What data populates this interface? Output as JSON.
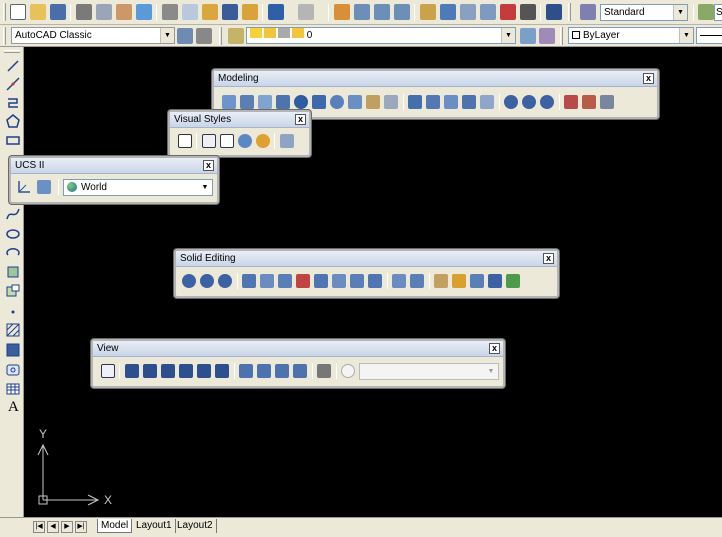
{
  "toolbar1": {
    "text_style_combo": "Standard",
    "cut_text": "S"
  },
  "toolbar2": {
    "workspace_combo": "AutoCAD Classic",
    "layer_combo": "0",
    "color_combo": "ByLayer"
  },
  "panels": {
    "modeling": {
      "title": "Modeling",
      "close": "x"
    },
    "visual_styles": {
      "title": "Visual Styles",
      "close": "x"
    },
    "ucs2": {
      "title": "UCS II",
      "close": "x",
      "combo_value": "World"
    },
    "solid_editing": {
      "title": "Solid Editing",
      "close": "x"
    },
    "view": {
      "title": "View",
      "close": "x"
    }
  },
  "left_toolbar": {
    "text_tool": "A"
  },
  "ucs_icon": {
    "y_label": "Y",
    "x_label": "X"
  },
  "tabs": {
    "model": "Model",
    "layout1": "Layout1",
    "layout2": "Layout2"
  },
  "colors": {
    "canvas": "#000000",
    "toolbar_bg": "#ece9d8",
    "title_bar": "#c9d5e8"
  }
}
